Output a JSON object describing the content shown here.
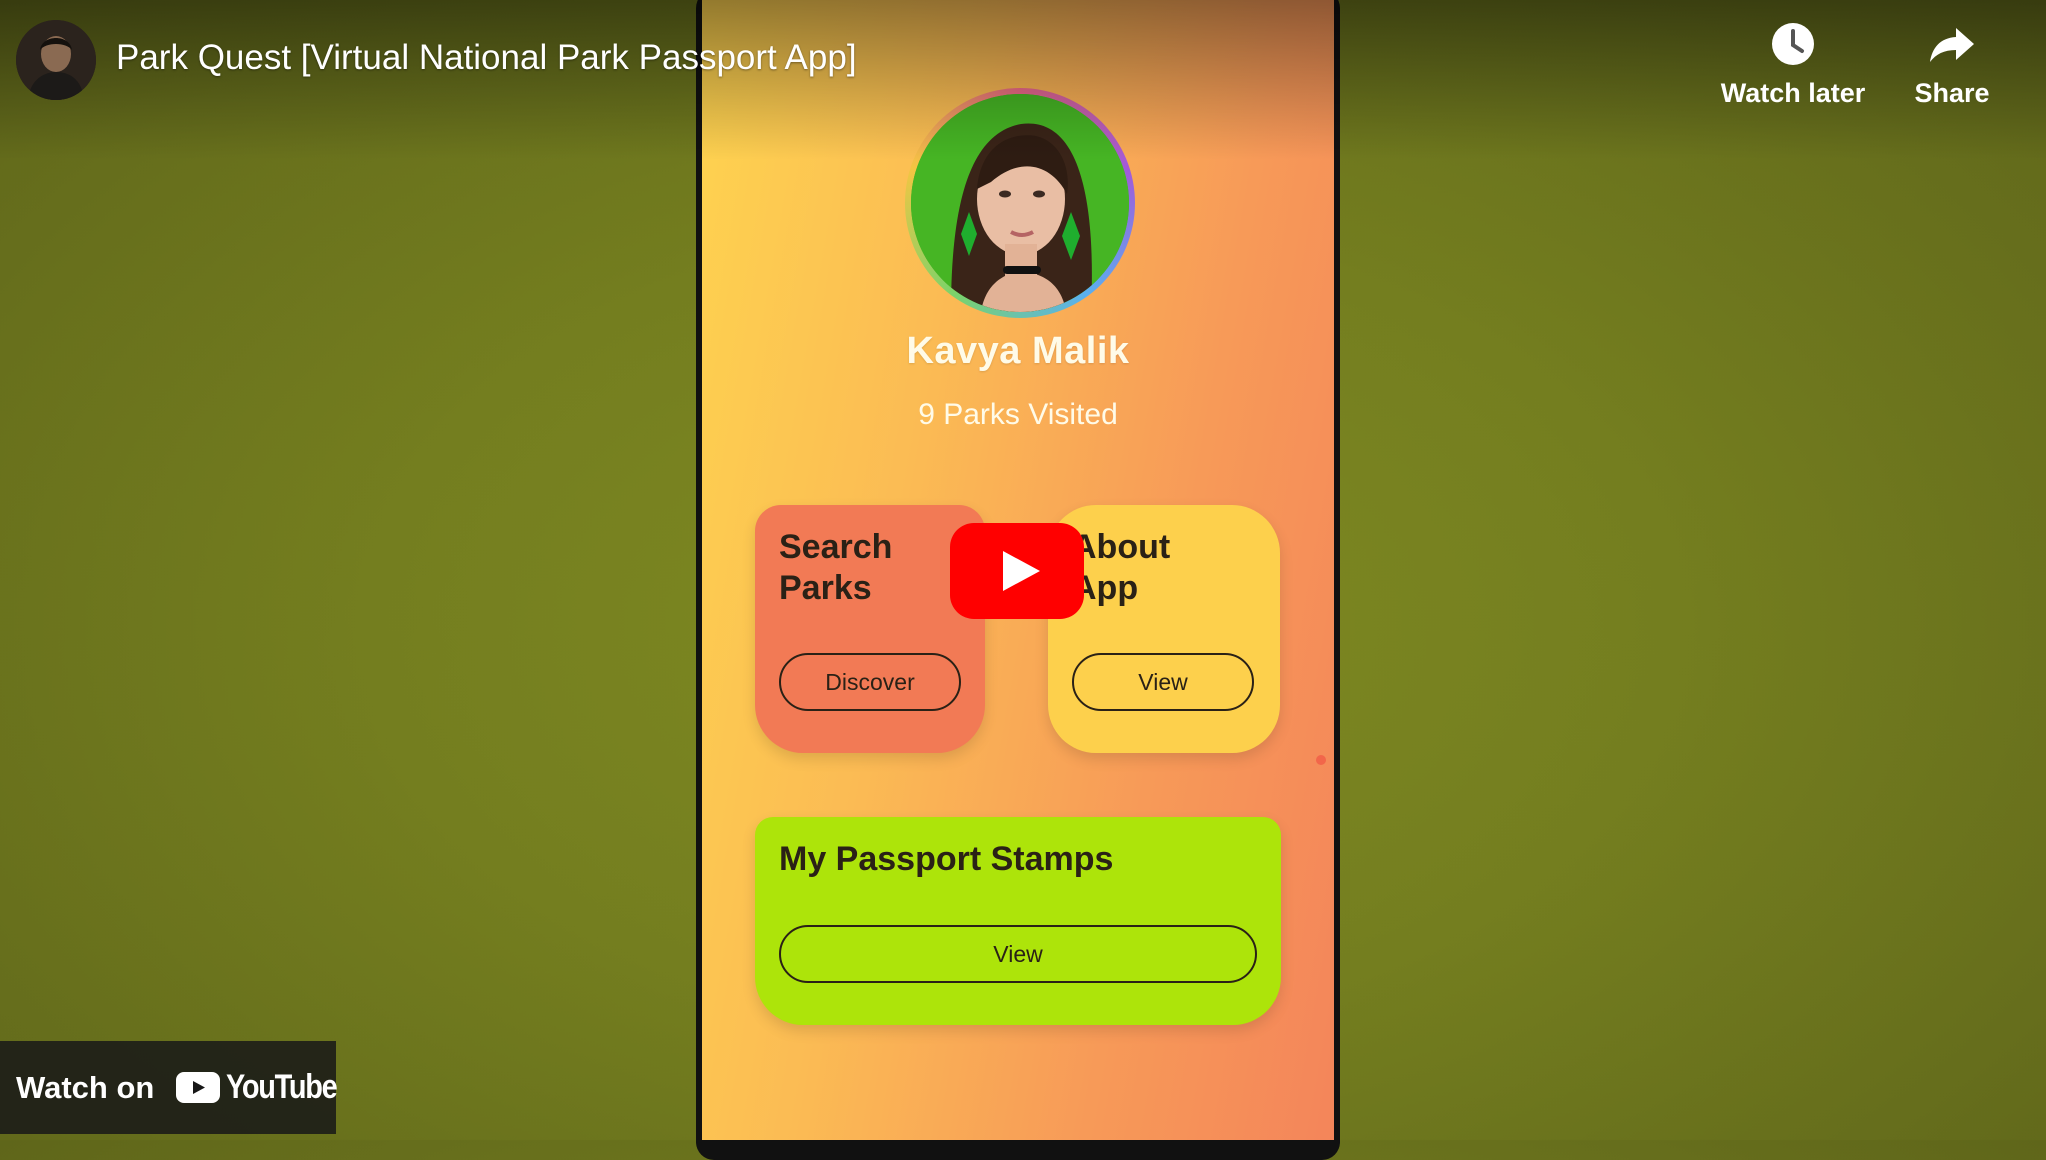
{
  "video": {
    "title": "Park Quest [Virtual National Park Passport App]"
  },
  "actions": {
    "watch_later": "Watch later",
    "share": "Share"
  },
  "footer": {
    "watch_on": "Watch on",
    "brand": "YouTube"
  },
  "app": {
    "profile": {
      "name": "Kavya Malik",
      "parks_visited": "9 Parks Visited"
    },
    "cards": {
      "search": {
        "title": "Search\nParks",
        "button": "Discover"
      },
      "about": {
        "title": "About\nApp",
        "button": "View"
      },
      "stamps": {
        "title": "My Passport Stamps",
        "button": "View"
      }
    }
  },
  "colors": {
    "youtube_red": "#ff0000",
    "search_card": "#f27a55",
    "about_card": "#fdd04c",
    "stamps_card": "#ade40a"
  }
}
